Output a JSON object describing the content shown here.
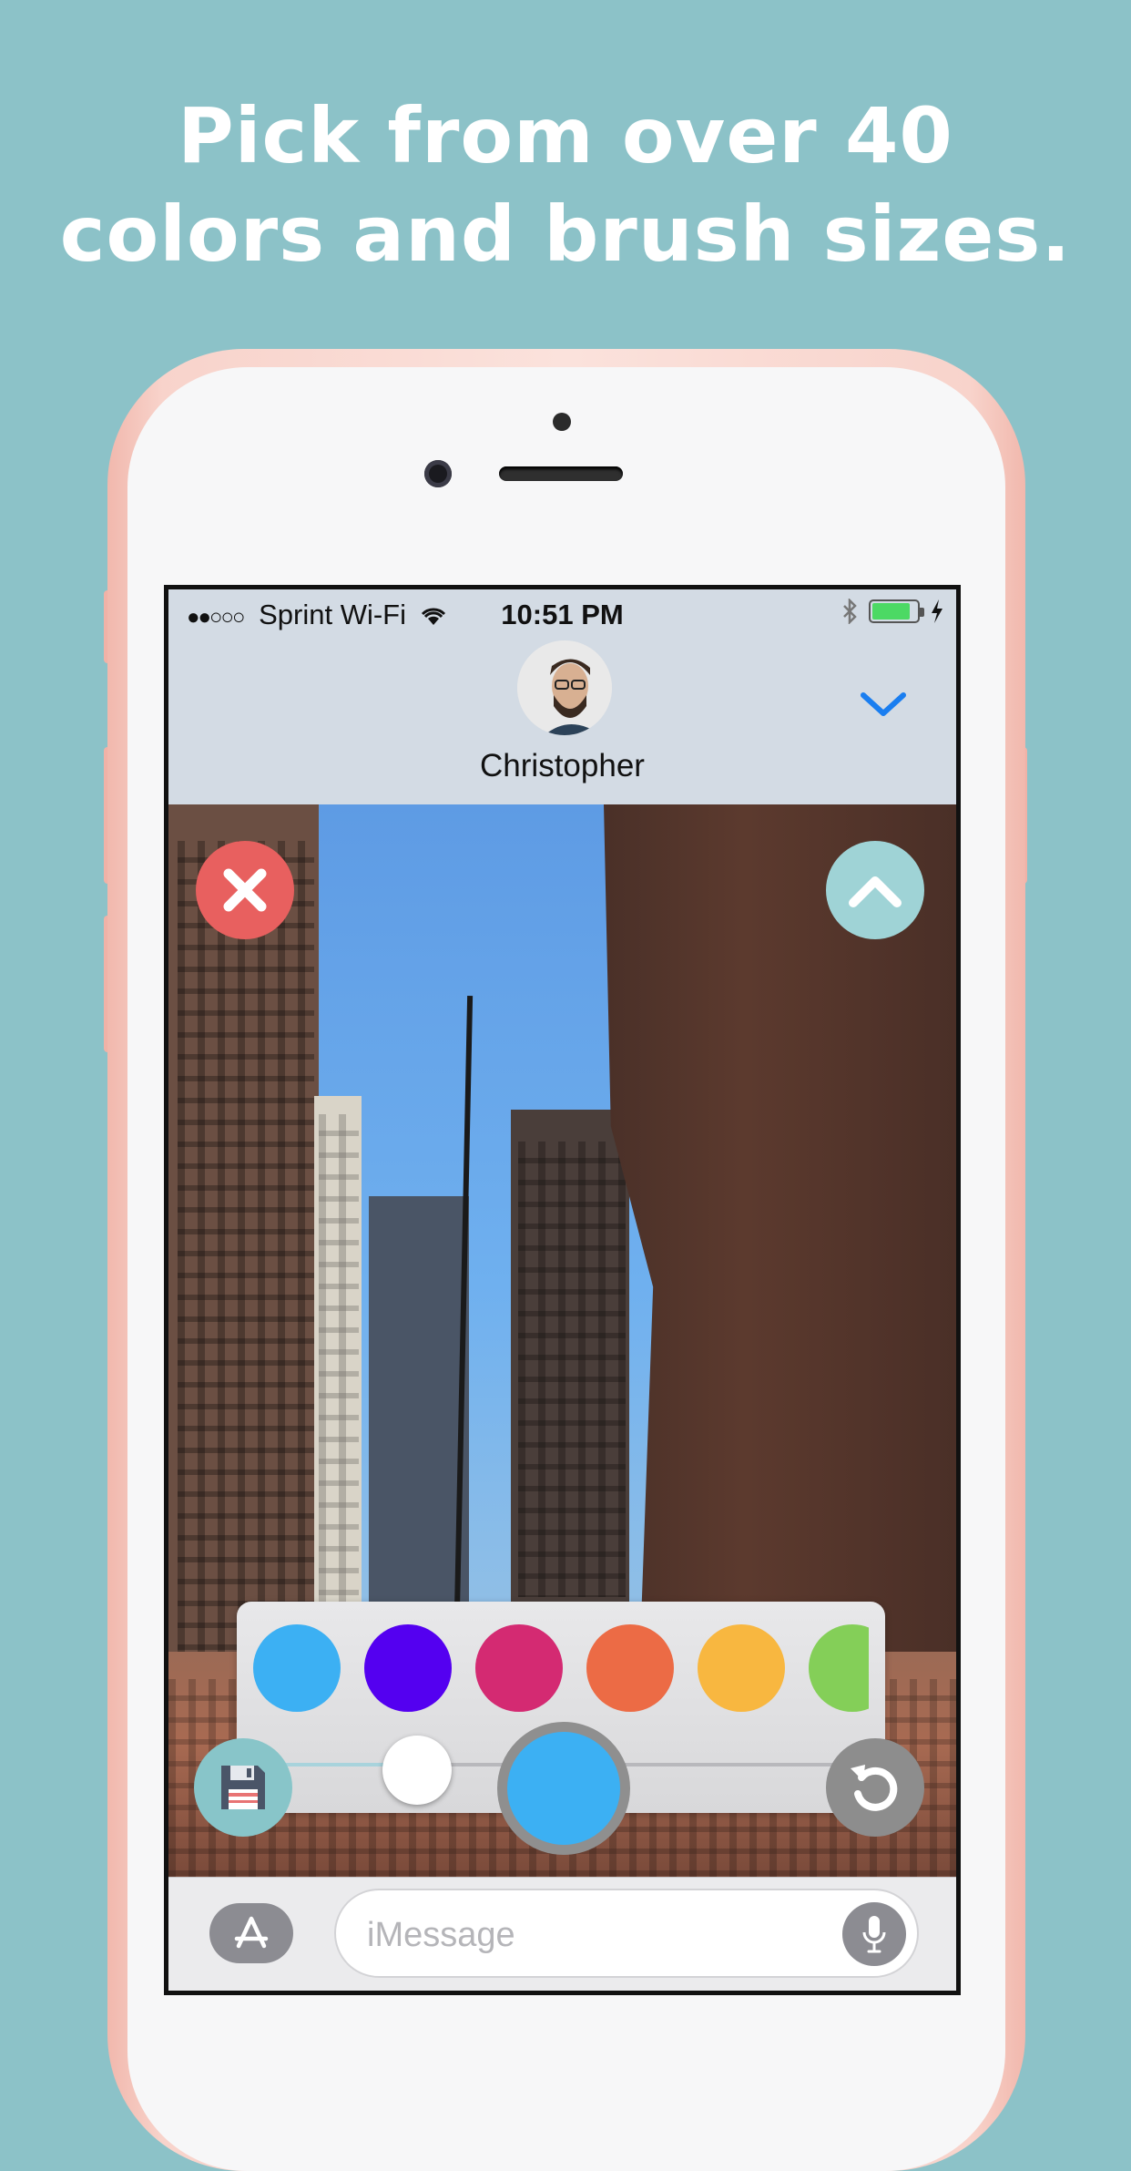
{
  "headline": {
    "line1": "Pick from over 40",
    "line2": "colors and brush sizes."
  },
  "status_bar": {
    "carrier": "Sprint Wi-Fi",
    "signal_dots": "●●○○○",
    "time": "10:51 PM",
    "battery_level": 0.85,
    "icons": [
      "wifi-icon",
      "bluetooth-icon",
      "battery-icon",
      "charging-bolt-icon"
    ]
  },
  "conversation": {
    "contact_name": "Christopher",
    "collapse_icon": "chevron-down-icon"
  },
  "drawing_tools": {
    "close_icon": "close-icon",
    "expand_icon": "chevron-up-icon",
    "save_icon": "floppy-disk-icon",
    "undo_icon": "undo-icon",
    "current_color": "#3cb0f3",
    "swatches": [
      "#3cb0f3",
      "#5400f0",
      "#d42a72",
      "#ec6b45",
      "#f8b740",
      "#84cf58"
    ],
    "brush_size_fraction": 0.26
  },
  "message_input": {
    "placeholder": "iMessage",
    "apps_icon": "app-store-icon",
    "mic_icon": "microphone-icon"
  }
}
